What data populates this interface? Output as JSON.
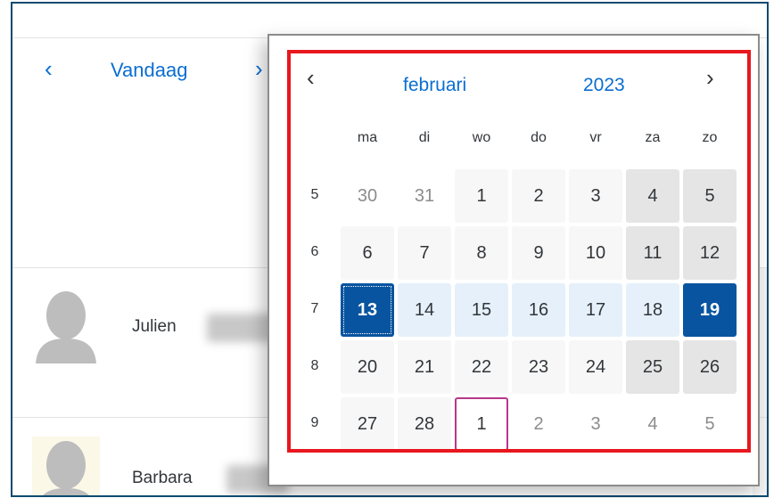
{
  "nav": {
    "prev_icon": "‹",
    "today_label": "Vandaag",
    "next_icon": "›"
  },
  "people": [
    {
      "name": "Julien"
    },
    {
      "name": "Barbara"
    }
  ],
  "calendar": {
    "prev_icon": "‹",
    "next_icon": "›",
    "month": "februari",
    "year": "2023",
    "weekdays": [
      "ma",
      "di",
      "wo",
      "do",
      "vr",
      "za",
      "zo"
    ],
    "weeks": [
      {
        "number": "5",
        "days": [
          {
            "label": "30",
            "state": "other"
          },
          {
            "label": "31",
            "state": "other"
          },
          {
            "label": "1",
            "state": "normal"
          },
          {
            "label": "2",
            "state": "normal"
          },
          {
            "label": "3",
            "state": "normal"
          },
          {
            "label": "4",
            "state": "weekend"
          },
          {
            "label": "5",
            "state": "weekend"
          }
        ]
      },
      {
        "number": "6",
        "days": [
          {
            "label": "6",
            "state": "normal"
          },
          {
            "label": "7",
            "state": "normal"
          },
          {
            "label": "8",
            "state": "normal"
          },
          {
            "label": "9",
            "state": "normal"
          },
          {
            "label": "10",
            "state": "normal"
          },
          {
            "label": "11",
            "state": "weekend"
          },
          {
            "label": "12",
            "state": "weekend"
          }
        ]
      },
      {
        "number": "7",
        "days": [
          {
            "label": "13",
            "state": "selected-start"
          },
          {
            "label": "14",
            "state": "range"
          },
          {
            "label": "15",
            "state": "range"
          },
          {
            "label": "16",
            "state": "range"
          },
          {
            "label": "17",
            "state": "range"
          },
          {
            "label": "18",
            "state": "range"
          },
          {
            "label": "19",
            "state": "selected-end"
          }
        ]
      },
      {
        "number": "8",
        "days": [
          {
            "label": "20",
            "state": "normal"
          },
          {
            "label": "21",
            "state": "normal"
          },
          {
            "label": "22",
            "state": "normal"
          },
          {
            "label": "23",
            "state": "normal"
          },
          {
            "label": "24",
            "state": "normal"
          },
          {
            "label": "25",
            "state": "weekend"
          },
          {
            "label": "26",
            "state": "weekend"
          }
        ]
      },
      {
        "number": "9",
        "days": [
          {
            "label": "27",
            "state": "normal"
          },
          {
            "label": "28",
            "state": "normal"
          },
          {
            "label": "1",
            "state": "today"
          },
          {
            "label": "2",
            "state": "other"
          },
          {
            "label": "3",
            "state": "other"
          },
          {
            "label": "4",
            "state": "other"
          },
          {
            "label": "5",
            "state": "other"
          }
        ]
      }
    ]
  },
  "colors": {
    "accent": "#0a6ed1",
    "selected": "#0854a0",
    "range": "#e5f0fa",
    "weekend": "#e5e5e5",
    "today_border": "#b9378b",
    "highlight_box": "#e8171e",
    "frame_border": "#0b4a6f"
  }
}
